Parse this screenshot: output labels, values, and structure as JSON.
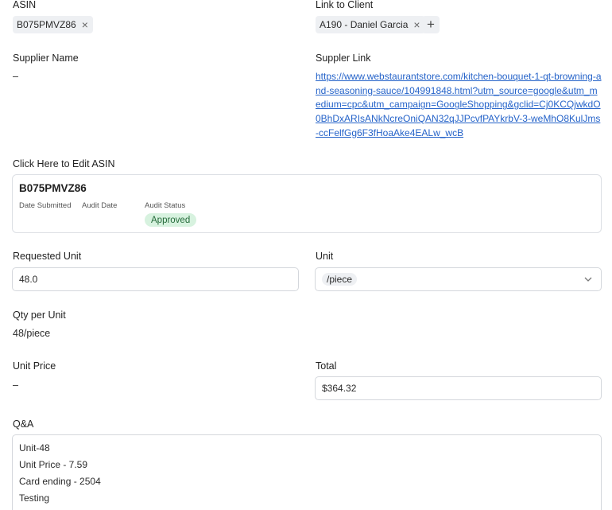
{
  "asin_field": {
    "label": "ASIN",
    "chip": "B075PMVZ86"
  },
  "client_field": {
    "label": "Link to Client",
    "chip": "A190 - Daniel Garcia"
  },
  "supplier_name": {
    "label": "Supplier Name",
    "value": "–"
  },
  "supplier_link": {
    "label": "Suppler Link",
    "url": "https://www.webstaurantstore.com/kitchen-bouquet-1-qt-browning-and-seasoning-sauce/104991848.html?utm_source=google&utm_medium=cpc&utm_campaign=GoogleShopping&gclid=Cj0KCQjwkdO0BhDxARIsANkNcreOniQAN32qJJPcvfPAYkrbV-3-weMhO8KulJms-ccFelfGg6F3fHoaAke4EALw_wcB"
  },
  "edit_asin": {
    "label": "Click Here to Edit ASIN",
    "asin": "B075PMVZ86",
    "date_submitted_label": "Date Submitted",
    "audit_date_label": "Audit Date",
    "audit_status_label": "Audit Status",
    "audit_status": "Approved",
    "status_color": "#d7f2df"
  },
  "requested_unit": {
    "label": "Requested Unit",
    "value": "48.0"
  },
  "unit": {
    "label": "Unit",
    "selected": "/piece"
  },
  "qty_per_unit": {
    "label": "Qty per Unit",
    "value": "48/piece"
  },
  "unit_price": {
    "label": "Unit Price",
    "value": "–"
  },
  "total": {
    "label": "Total",
    "value": "$364.32"
  },
  "qa": {
    "label": "Q&A",
    "lines": [
      "Unit-48",
      "Unit Price - 7.59",
      "Card ending - 2504",
      "Testing"
    ]
  },
  "link_color": "#2563c9"
}
